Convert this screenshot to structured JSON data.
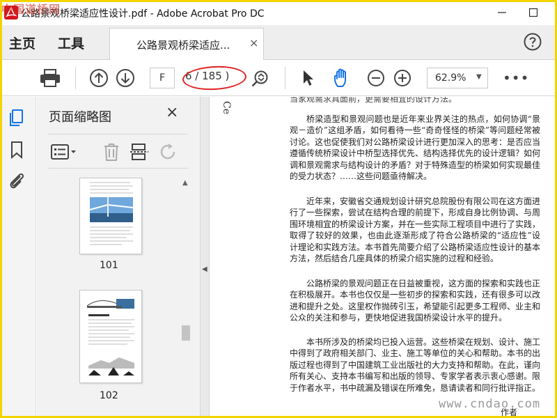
{
  "window": {
    "title": "公路景观桥梁适应性设计.pdf - Adobe Acrobat Pro DC",
    "watermark_top": "中国道桥网",
    "watermark_bottom": "www.cndao.com"
  },
  "tabs": {
    "home": "主页",
    "tools": "工具",
    "document": "公路景观桥梁适应...",
    "close_symbol": "×"
  },
  "toolbar": {
    "page_field": "F",
    "page_count": "6 / 185 )",
    "zoom": "62.9%",
    "more": "•••"
  },
  "thumbnails_panel": {
    "title": "页面缩略图",
    "close_symbol": "×",
    "pages": [
      {
        "number": "101"
      },
      {
        "number": "102"
      }
    ]
  },
  "document": {
    "rotated_label": "Ce",
    "cut_line": "当家观需求具面前，更需要相宜的设计方法。",
    "paragraphs": [
      "桥梁造型和景观问题也是近年来业界关注的热点，如何协调“景观－造价”这组矛盾，如何看待一些“奇奇怪怪的桥梁”等问题经常被讨论。这也促使我们对公路桥梁设计进行更加深入的思考：是否应当遵循传统桥梁设计中桥型选择优先、结构选择优先的设计逻辑？如何调和景观需求与结构设计的矛盾？对于特殊造型的桥梁如何实现最佳的受力状态？……这些问题亟待解决。",
      "近年来，安徽省交通规划设计研究总院股份有限公司在这方面进行了一些探索，尝试在结构合理的前提下，形成自身比例协调、与周围环境相宜的桥梁设计方案，并在一些实际工程项目中进行了实践，取得了较好的效果，也由此逐渐形成了符合公路桥梁的“适应性”设计理论和实践方法。本书首先简要介绍了公路桥梁适应性设计的基本方法，然后结合几座具体的桥梁介绍实施的过程和经验。",
      "公路桥梁的景观问题正在日益被重视，这方面的探索和实践也正在积极展开。本书也仅仅是一些初步的探索和实践，还有很多可以改进和提升之处。这里权作抛砖引玉，希望能引起更多工程师、业主和公众的关注和参与，更快地促进我国桥梁设计水平的提升。",
      "本书所涉及的桥梁均已投入运营。这些桥梁在规划、设计、施工中得到了政府相关部门、业主、施工等单位的关心和帮助。本书的出版过程也得到了中国建筑工业出版社的大力支持和帮助。在此，谨向所有关心、支持本书编写和出版的领导、专家学者表示衷心感谢。限于作者水平，书中疏漏及错误在所难免，恳请读者和同行批评指正。"
    ],
    "author": "作者"
  },
  "colors": {
    "frame": "#f2d500",
    "accent_blue": "#1473e6",
    "highlight_red": "#e02020",
    "pdf_red": "#d4141c"
  }
}
